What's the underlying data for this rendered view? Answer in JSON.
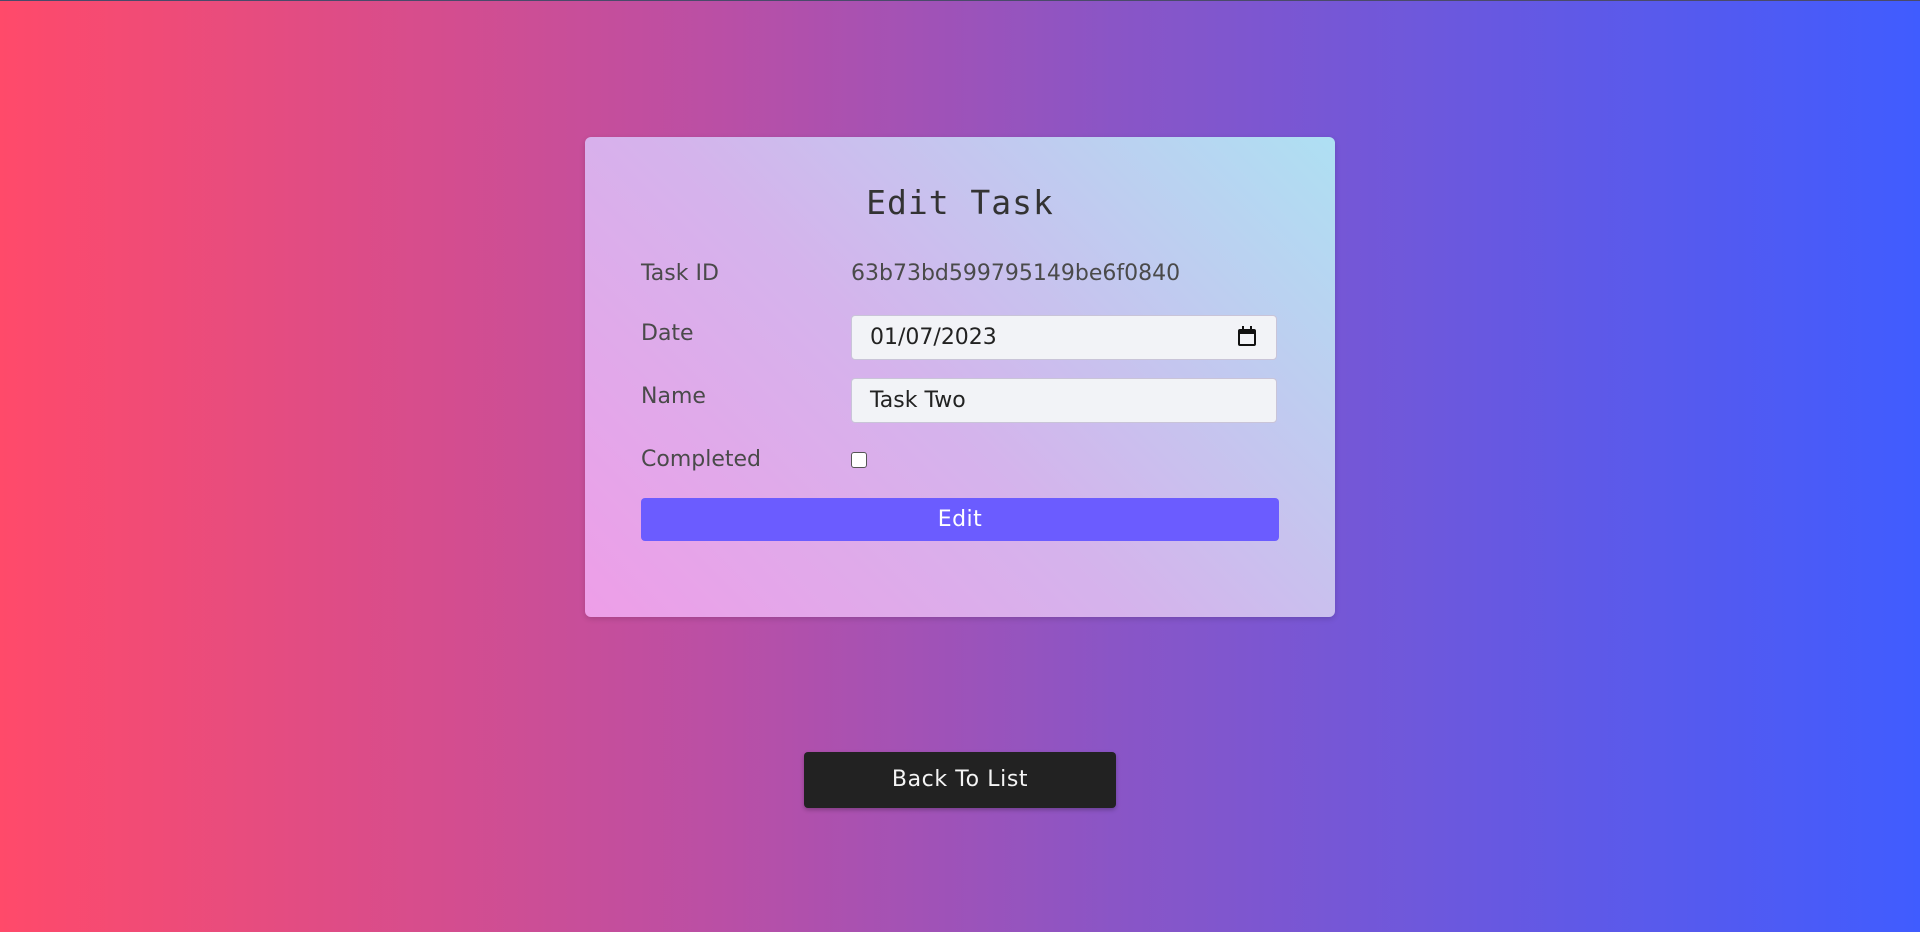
{
  "form": {
    "title": "Edit Task",
    "task_id_label": "Task ID",
    "task_id_value": "63b73bd599795149be6f0840",
    "date_label": "Date",
    "date_value": "01/07/2023",
    "name_label": "Name",
    "name_value": "Task Two",
    "completed_label": "Completed",
    "completed_checked": false,
    "edit_button_label": "Edit"
  },
  "footer": {
    "back_button_label": "Back To List"
  },
  "icons": {
    "date_picker": "calendar-icon"
  },
  "colors": {
    "primary_button": "#6b5cff",
    "back_button": "#222222",
    "gradient_left": "#ff4a6a",
    "gradient_right": "#405cff"
  }
}
